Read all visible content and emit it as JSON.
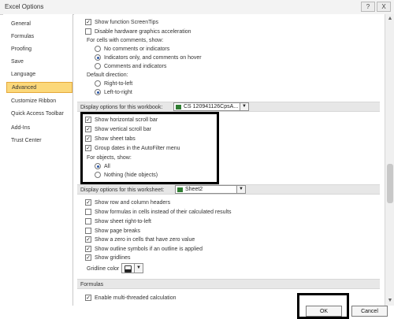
{
  "window": {
    "title": "Excel Options",
    "help_label": "?",
    "close_label": "X"
  },
  "sidebar": {
    "items": [
      {
        "label": "General"
      },
      {
        "label": "Formulas"
      },
      {
        "label": "Proofing"
      },
      {
        "label": "Save"
      },
      {
        "label": "Language"
      },
      {
        "label": "Advanced",
        "selected": true
      },
      {
        "label": "Customize Ribbon"
      },
      {
        "label": "Quick Access Toolbar"
      },
      {
        "label": "Add-Ins"
      },
      {
        "label": "Trust Center"
      }
    ]
  },
  "advanced": {
    "show_function_screentips": {
      "label": "Show function ScreenTips",
      "checked": true
    },
    "disable_hw_accel": {
      "label": "Disable hardware graphics acceleration",
      "checked": false
    },
    "comments_heading": "For cells with comments, show:",
    "comments_options": [
      {
        "label": "No comments or indicators",
        "selected": false
      },
      {
        "label": "Indicators only, and comments on hover",
        "selected": true
      },
      {
        "label": "Comments and indicators",
        "selected": false
      }
    ],
    "direction_heading": "Default direction:",
    "direction_options": [
      {
        "label": "Right-to-left",
        "selected": false
      },
      {
        "label": "Left-to-right",
        "selected": true
      }
    ],
    "workbook_section": {
      "label": "Display options for this workbook:",
      "dropdown_value": "CS 120941126CpsA...",
      "dropdown_arrow": "▼"
    },
    "workbook_options": [
      {
        "label": "Show horizontal scroll bar",
        "checked": true
      },
      {
        "label": "Show vertical scroll bar",
        "checked": true
      },
      {
        "label": "Show sheet tabs",
        "checked": true
      },
      {
        "label": "Group dates in the AutoFilter menu",
        "checked": true
      }
    ],
    "objects_heading": "For objects, show:",
    "objects_options": [
      {
        "label": "All",
        "selected": true
      },
      {
        "label": "Nothing (hide objects)",
        "selected": false
      }
    ],
    "worksheet_section": {
      "label": "Display options for this worksheet:",
      "dropdown_value": "Sheet2",
      "dropdown_arrow": "▼"
    },
    "worksheet_options": [
      {
        "label": "Show row and column headers",
        "checked": true
      },
      {
        "label": "Show formulas in cells instead of their calculated results",
        "checked": false
      },
      {
        "label": "Show sheet right-to-left",
        "checked": false
      },
      {
        "label": "Show page breaks",
        "checked": false
      },
      {
        "label": "Show a zero in cells that have zero value",
        "checked": true
      },
      {
        "label": "Show outline symbols if an outline is applied",
        "checked": true
      },
      {
        "label": "Show gridlines",
        "checked": true
      }
    ],
    "gridline_color_label": "Gridline color",
    "gridline_color_arrow": "▼",
    "formulas_section_label": "Formulas",
    "multithread": {
      "label": "Enable multi-threaded calculation",
      "checked": true
    }
  },
  "footer": {
    "ok_label": "OK",
    "cancel_label": "Cancel"
  },
  "icons": {
    "check_mark": "✓",
    "scroll_up": "▲",
    "scroll_down": "▼"
  },
  "colors": {
    "selected_nav_bg": "#fbd87a",
    "highlight_border": "#000000"
  }
}
